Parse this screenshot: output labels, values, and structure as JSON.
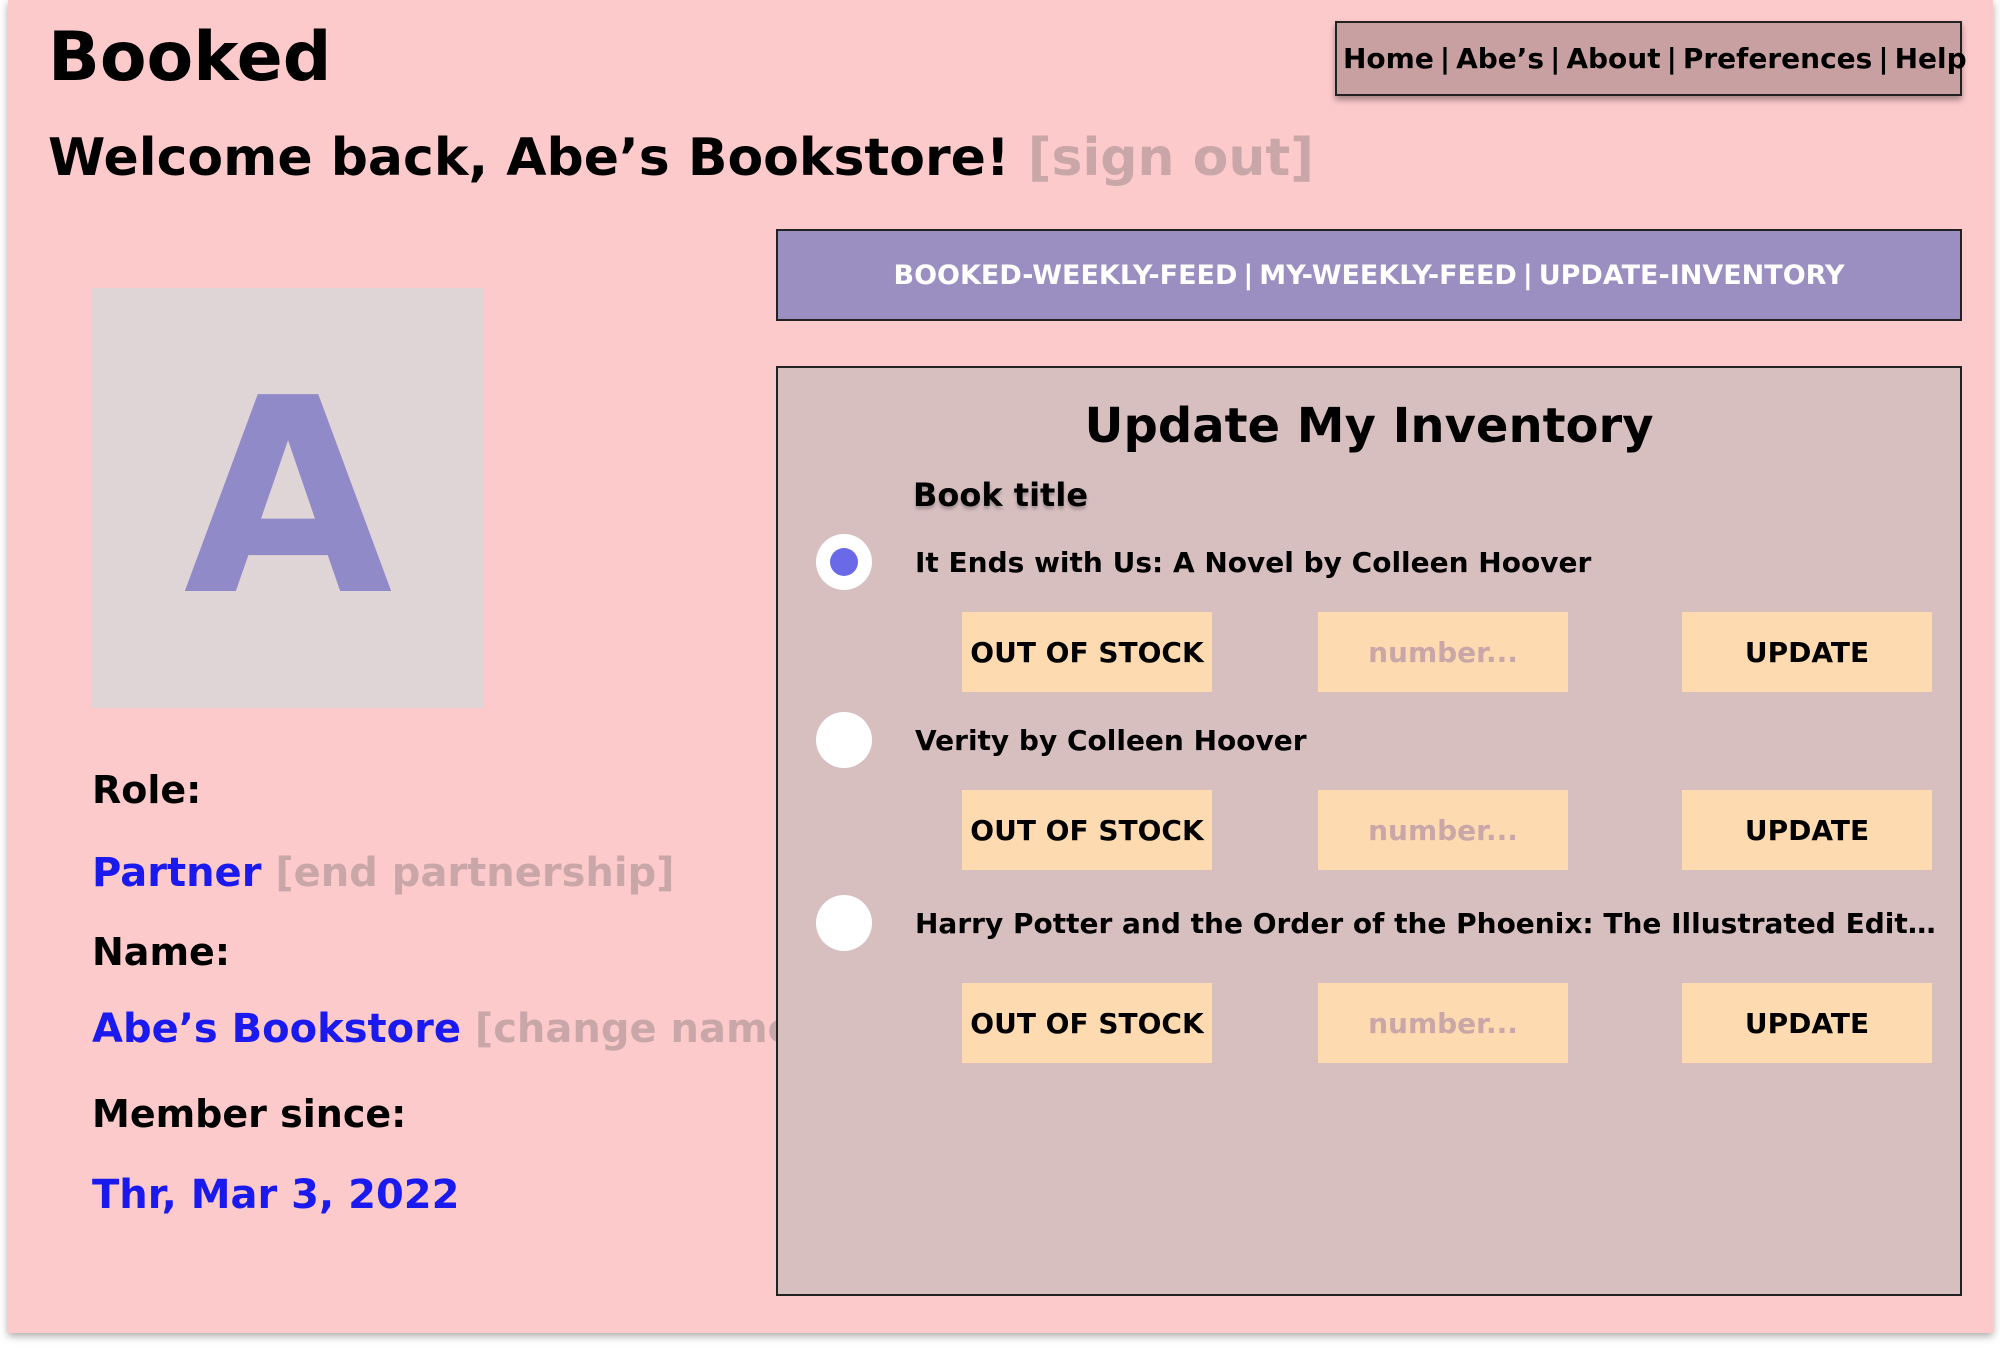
{
  "app": {
    "title": "Booked"
  },
  "welcome": {
    "greeting": "Welcome back, Abe’s Bookstore!",
    "sign_out": "[sign out]"
  },
  "nav": {
    "items": [
      "Home",
      "Abe’s",
      "About",
      "Preferences",
      "Help"
    ],
    "separator": "|"
  },
  "tabs": {
    "items": [
      "BOOKED-WEEKLY-FEED",
      "MY-WEEKLY-FEED",
      "UPDATE-INVENTORY"
    ],
    "separator": "|"
  },
  "profile": {
    "avatar_letter": "A",
    "role_label": "Role:",
    "role_value": "Partner",
    "role_action": "[end partnership]",
    "name_label": "Name:",
    "name_value": "Abe’s Bookstore",
    "name_action": "[change name]",
    "since_label": "Member since:",
    "since_value": "Thr, Mar 3, 2022"
  },
  "inventory": {
    "title": "Update My Inventory",
    "column_header": "Book title",
    "books": [
      {
        "title": "It Ends with Us: A Novel by Colleen Hoover",
        "selected": true,
        "out_of_stock_label": "OUT OF STOCK",
        "number_placeholder": "number...",
        "update_label": "UPDATE"
      },
      {
        "title": "Verity by Colleen Hoover",
        "selected": false,
        "out_of_stock_label": "OUT OF STOCK",
        "number_placeholder": "number...",
        "update_label": "UPDATE"
      },
      {
        "title": "Harry Potter and the Order of the Phoenix: The Illustrated Edition by J. K. ..",
        "selected": false,
        "out_of_stock_label": "OUT OF STOCK",
        "number_placeholder": "number...",
        "update_label": "UPDATE"
      }
    ]
  },
  "colors": {
    "background": "#fdcacb",
    "nav_bg": "#c9a0a1",
    "tab_bar_bg": "#9b8fc2",
    "panel_bg": "#d7bfc0",
    "button_bg": "#fddab0",
    "link_blue": "#1a1aee",
    "muted_text": "#c9a7a8",
    "radio_selected": "#6a6ae8",
    "avatar_letter": "#918ac9"
  }
}
